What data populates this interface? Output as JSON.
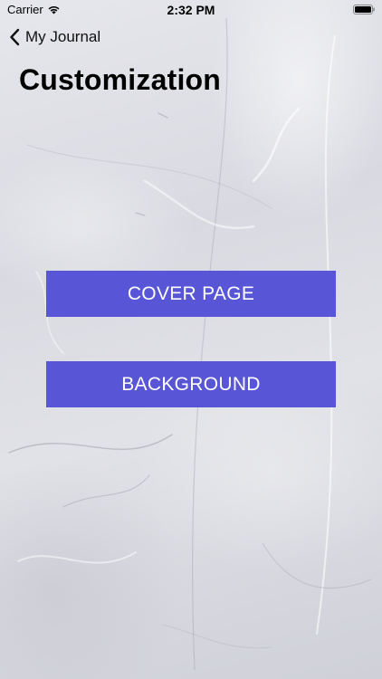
{
  "status_bar": {
    "carrier": "Carrier",
    "time": "2:32 PM",
    "wifi_icon": "wifi-icon",
    "battery_icon": "battery-icon"
  },
  "nav": {
    "back_label": "My Journal",
    "back_icon": "chevron-left-icon"
  },
  "page": {
    "title": "Customization"
  },
  "buttons": {
    "cover_page": "COVER PAGE",
    "background": "BACKGROUND"
  },
  "colors": {
    "button_bg": "#5856d6",
    "button_text": "#ffffff",
    "background": "#dfe0e5"
  }
}
